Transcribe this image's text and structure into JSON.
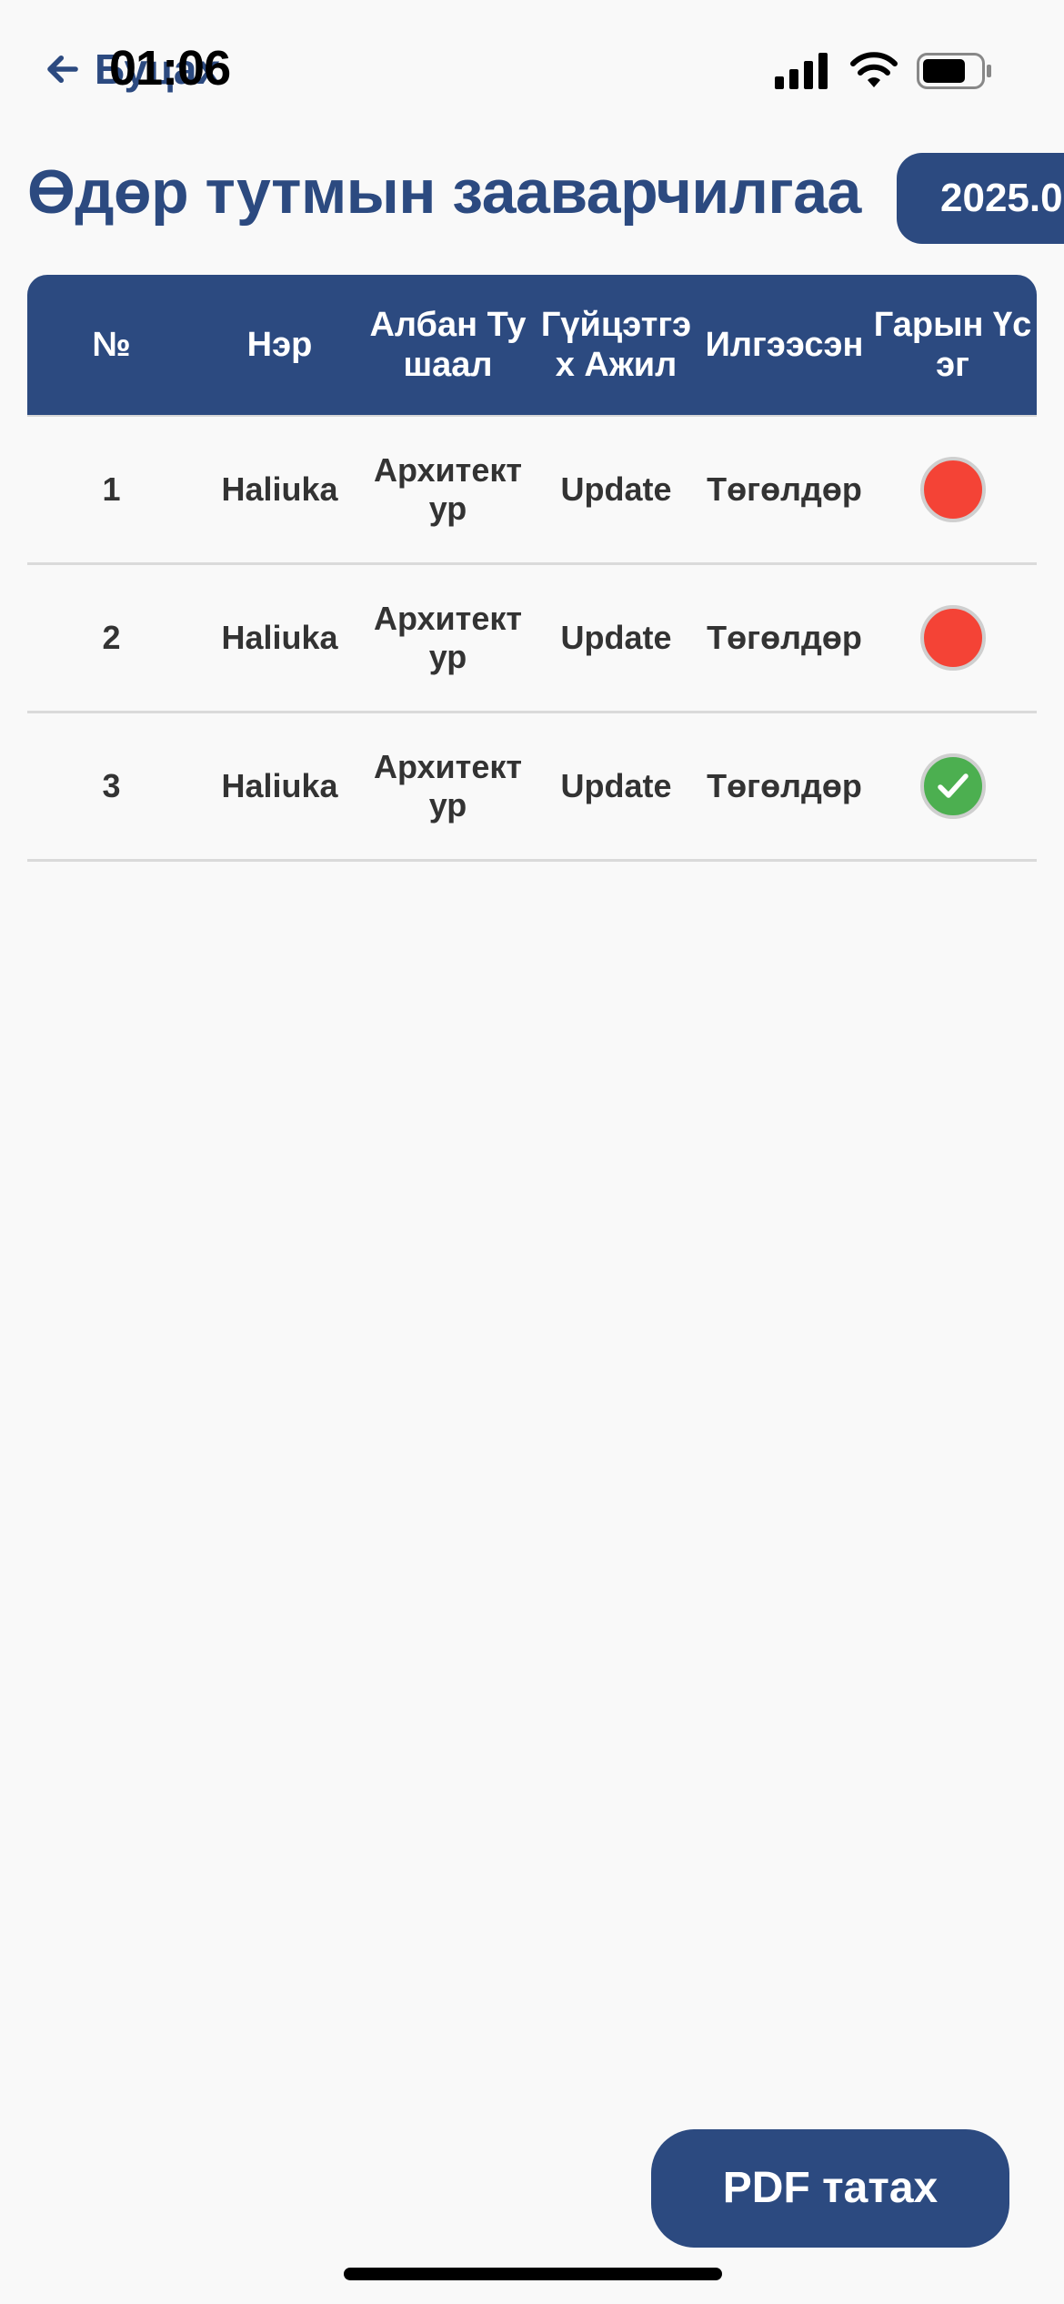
{
  "status_bar": {
    "time": "01:06"
  },
  "nav": {
    "back_label": "Буцах"
  },
  "header": {
    "title": "Өдөр тутмын зааварчилгаа",
    "date": "2025.0"
  },
  "table": {
    "columns": [
      "№",
      "Нэр",
      "Албан Тушаал",
      "Гүйцэтгэх Ажил",
      "Илгээсэн",
      "Гарын Үсэг"
    ],
    "rows": [
      {
        "num": "1",
        "name": "Haliuka",
        "position": "Архитектур",
        "task": "Update",
        "sent": "Төгөлдөр",
        "signature": "unsigned"
      },
      {
        "num": "2",
        "name": "Haliuka",
        "position": "Архитектур",
        "task": "Update",
        "sent": "Төгөлдөр",
        "signature": "unsigned"
      },
      {
        "num": "3",
        "name": "Haliuka",
        "position": "Архитектур",
        "task": "Update",
        "sent": "Төгөлдөр",
        "signature": "signed"
      }
    ]
  },
  "footer": {
    "pdf_button_label": "PDF татах"
  },
  "colors": {
    "primary": "#2c4a80",
    "background": "#f9f9f9",
    "unsigned": "#f44336",
    "signed": "#4caf50"
  }
}
